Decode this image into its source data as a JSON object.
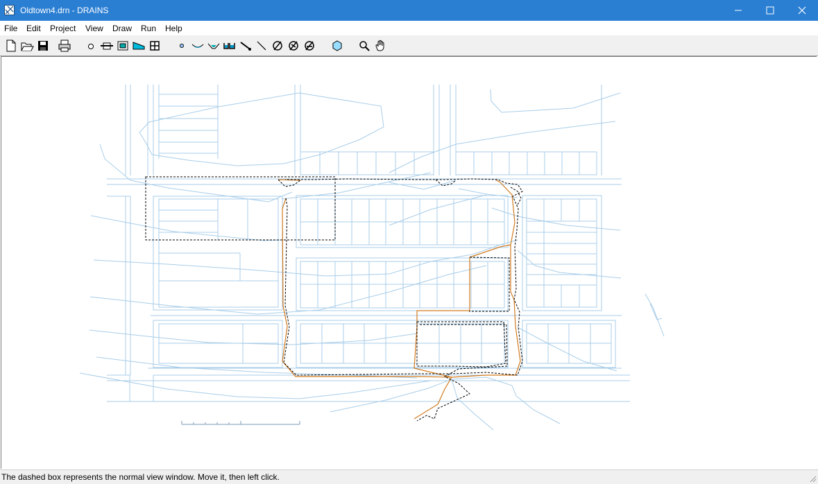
{
  "window": {
    "title": "Oldtown4.drn - DRAINS",
    "controls": {
      "minimize": "—",
      "maximize": "☐",
      "close": "✕"
    }
  },
  "menu": [
    "File",
    "Edit",
    "Project",
    "View",
    "Draw",
    "Run",
    "Help"
  ],
  "toolbar": {
    "buttons": [
      "new-file-icon",
      "open-folder-icon",
      "save-disk-icon",
      "print-icon",
      "node-circle-icon",
      "pit-icon",
      "detention-basin-icon",
      "channel-icon",
      "grid-icon",
      "small-node-icon",
      "open-channel-icon",
      "overflow-route-icon",
      "culvert-icon",
      "pipe-link-icon",
      "line-icon",
      "no-node-icon",
      "no-link-icon",
      "no-overflow-icon",
      "hexagon-icon",
      "zoom-icon",
      "pan-hand-icon"
    ]
  },
  "status": {
    "message": "The dashed box represents the normal view window.  Move it, then left click."
  },
  "colors": {
    "titlebar": "#2b7fd3",
    "property_lines": "#a8cde9",
    "pipes": "#d07a1e",
    "view_box": "#000000"
  }
}
